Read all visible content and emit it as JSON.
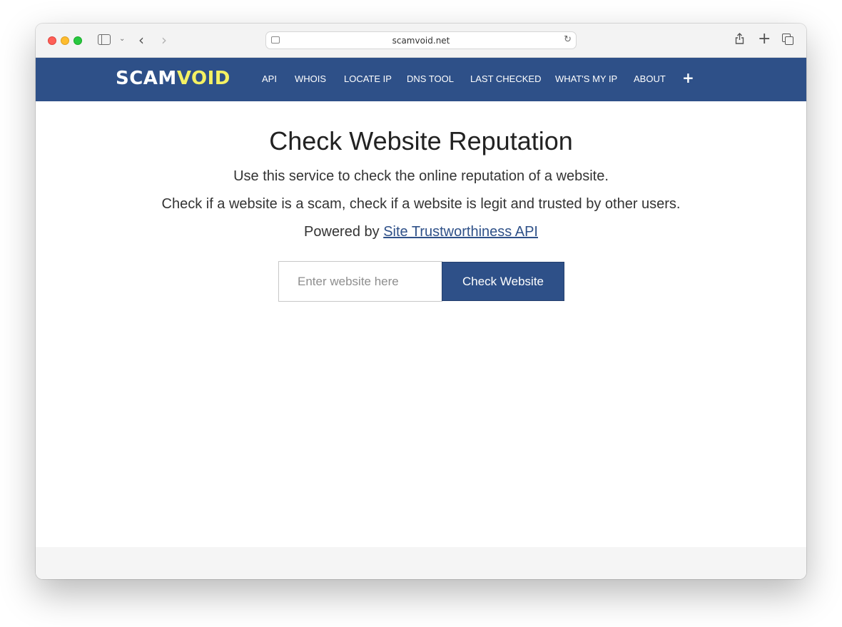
{
  "browser": {
    "url": "scamvoid.net"
  },
  "site": {
    "logo_part1": "SCAM",
    "logo_part2": "VOID",
    "nav": [
      "API",
      "WHOIS",
      "LOCATE IP",
      "DNS TOOL",
      "LAST CHECKED",
      "WHAT'S MY IP",
      "ABOUT"
    ],
    "nav_more": "+"
  },
  "main": {
    "title": "Check Website Reputation",
    "line1": "Use this service to check the online reputation of a website.",
    "line2": "Check if a website is a scam, check if a website is legit and trusted by other users.",
    "powered_prefix": "Powered by ",
    "powered_link": "Site Trustworthiness API",
    "input_placeholder": "Enter website here",
    "input_value": "",
    "button_label": "Check Website"
  },
  "colors": {
    "nav_bg": "#2e5088",
    "logo_accent": "#f4f163",
    "button_bg": "#2e5088"
  },
  "icons": [
    "sidebar-icon",
    "chevron-down-icon",
    "back-icon",
    "forward-icon",
    "page-icon",
    "reload-icon",
    "share-icon",
    "new-tab-icon",
    "tab-overview-icon"
  ]
}
